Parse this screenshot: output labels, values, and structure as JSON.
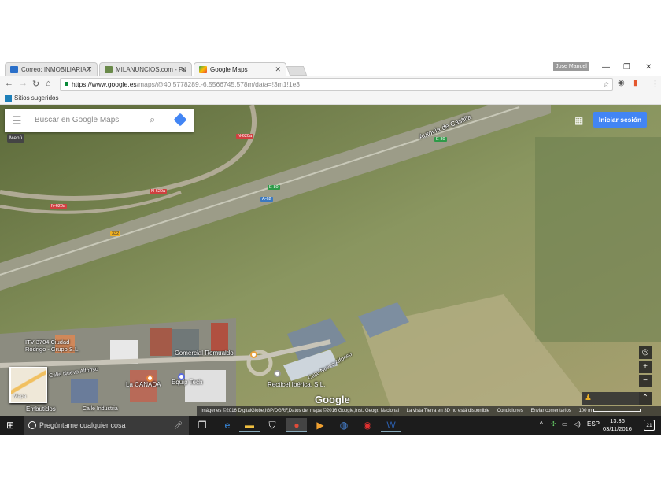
{
  "browser": {
    "tabs": [
      {
        "label": "Correo: INMOBILIARIA T",
        "active": false
      },
      {
        "label": "MILANUNCIOS.com - Pu",
        "active": false
      },
      {
        "label": "Google Maps",
        "active": true
      }
    ],
    "user": "Jose Manuel",
    "url_host": "https://www.google.es",
    "url_path": "/maps/@40.5778289,-6.5566745,578m/data=!3m1!1e3",
    "bookmark": "Sitios sugeridos"
  },
  "maps": {
    "search_placeholder": "Buscar en Google Maps",
    "menu_tooltip": "Menú",
    "signin": "Iniciar sesión",
    "minimap_label": "Mapa",
    "logo": "Google",
    "labels": {
      "autovia": "Autovía de Castilla",
      "itv": "ITV 3704 Ciudad Rodrigo - Grupo S.L.",
      "comercial": "Comercial Romualdo",
      "calle1": "Calle Nuevo Alfonso",
      "calle2": "Calle Nuevo Alfonso",
      "canada": "La CANADA",
      "equip": "Equip Tech",
      "recticel": "Recticel Ibérica, S.L.",
      "embutidos": "Embutidos",
      "industria": "Calle Industria"
    },
    "shields": {
      "n620a_1": "N-620a",
      "n620a_2": "N-620a",
      "n620a_3": "N-620a",
      "e80_1": "E-80",
      "e80_2": "E-80",
      "a62": "A-62",
      "r332": "332"
    },
    "attribution": [
      "Imágenes ©2016 DigitalGlobe,IGP/DGRF,Datos del mapa ©2016 Google,Inst. Geogr. Nacional",
      "La vista Tierra en 3D no está disponible",
      "Condiciones",
      "Enviar comentarios"
    ],
    "scale": "100 m"
  },
  "taskbar": {
    "search_placeholder": "Pregúntame cualquier cosa",
    "lang": "ESP",
    "time": "13:36",
    "date": "03/11/2016",
    "notifications": "21"
  }
}
